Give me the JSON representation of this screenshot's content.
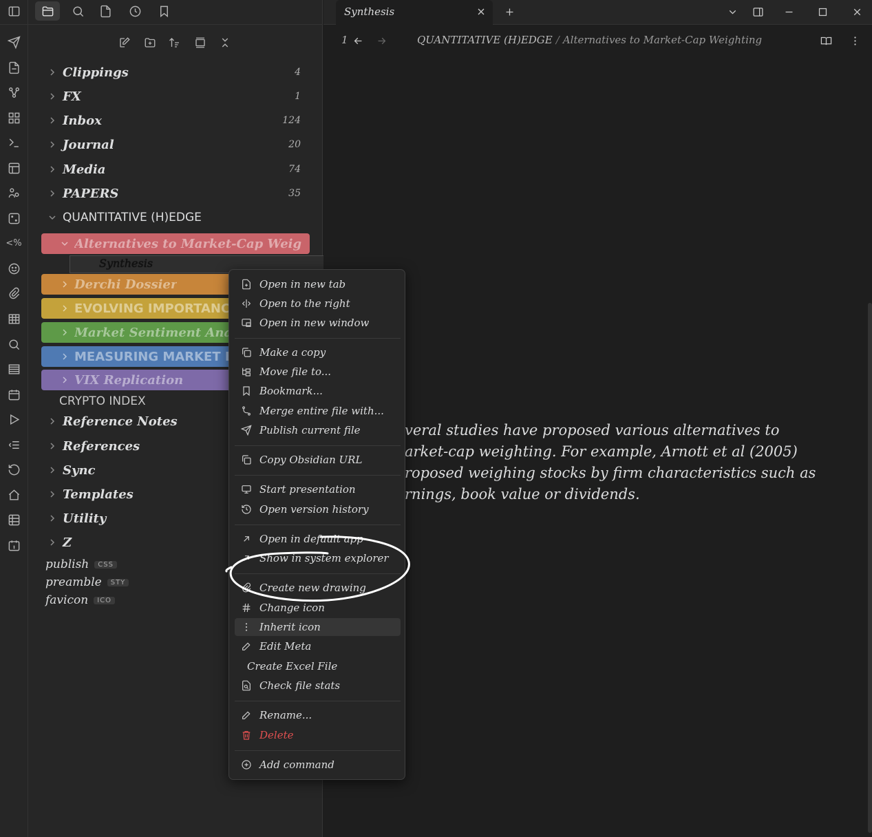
{
  "sidebar": {
    "tree": [
      {
        "label": "Clippings",
        "count": "4"
      },
      {
        "label": "FX",
        "count": "1"
      },
      {
        "label": "Inbox",
        "count": "124"
      },
      {
        "label": "Journal",
        "count": "20"
      },
      {
        "label": "Media",
        "count": "74"
      },
      {
        "label": "PAPERS",
        "count": "35"
      },
      {
        "label": "QUANTITATIVE (H)EDGE"
      }
    ],
    "subfolders": [
      {
        "label": "Alternatives to Market-Cap Weigh...",
        "color": "#c9646a"
      },
      {
        "label": "Derchi Dossier",
        "color": "#c7853a"
      },
      {
        "label": "EVOLVING IMPORTANCE",
        "color": "#c4a23b"
      },
      {
        "label": "Market Sentiment Analy",
        "color": "#5e9a48"
      },
      {
        "label": "MEASURING MARKET B",
        "color": "#4f7ab3"
      },
      {
        "label": "VIX Replication",
        "color": "#7e6aa8"
      }
    ],
    "active_file": "Synthesis",
    "crypto_index": "CRYPTO INDEX",
    "tree_lower": [
      {
        "label": "Reference Notes"
      },
      {
        "label": "References"
      },
      {
        "label": "Sync"
      },
      {
        "label": "Templates"
      },
      {
        "label": "Utility"
      },
      {
        "label": "Z"
      }
    ],
    "files": [
      {
        "label": "publish",
        "ext": "CSS"
      },
      {
        "label": "preamble",
        "ext": "STY"
      },
      {
        "label": "favicon",
        "ext": "ICO"
      }
    ]
  },
  "tab": {
    "title": "Synthesis"
  },
  "view": {
    "history_count": "1",
    "breadcrumb": [
      "QUANTITATIVE (H)EDGE",
      "/",
      "Alternatives to Market-Cap Weighting"
    ]
  },
  "content": {
    "paragraph": [
      "veral studies have proposed various alternatives to",
      "arket-cap weighting. For example, Arnott et al (2005)",
      "roposed weighing stocks by firm characteristics such as",
      "rnings, book value or dividends."
    ]
  },
  "context_menu": {
    "items": [
      {
        "label": "Open in new tab",
        "icon": "new-tab-icon"
      },
      {
        "label": "Open to the right",
        "icon": "split-icon"
      },
      {
        "label": "Open in new window",
        "icon": "window-icon"
      },
      {
        "label": "Make a copy",
        "icon": "copy-icon"
      },
      {
        "label": "Move file to...",
        "icon": "move-icon"
      },
      {
        "label": "Bookmark...",
        "icon": "bookmark-icon"
      },
      {
        "label": "Merge entire file with...",
        "icon": "merge-icon"
      },
      {
        "label": "Publish current file",
        "icon": "send-icon"
      },
      {
        "label": "Copy Obsidian URL",
        "icon": "copy-icon"
      },
      {
        "label": "Start presentation",
        "icon": "monitor-icon"
      },
      {
        "label": "Open version history",
        "icon": "history-icon"
      },
      {
        "label": "Open in default app",
        "icon": "external-link-icon"
      },
      {
        "label": "Show in system explorer",
        "icon": "external-link-icon"
      },
      {
        "label": "Create new drawing",
        "icon": "paperclip-icon"
      },
      {
        "label": "Change icon",
        "icon": "hash-icon"
      },
      {
        "label": "Inherit icon",
        "icon": "more-vertical-icon"
      },
      {
        "label": "Edit Meta",
        "icon": "pencil-icon"
      },
      {
        "label": "Create Excel File",
        "icon": ""
      },
      {
        "label": "Check file stats",
        "icon": "file-stats-icon"
      },
      {
        "label": "Rename...",
        "icon": "pencil-icon"
      },
      {
        "label": "Delete",
        "icon": "trash-icon"
      },
      {
        "label": "Add command",
        "icon": "plus-circle-icon"
      }
    ]
  }
}
